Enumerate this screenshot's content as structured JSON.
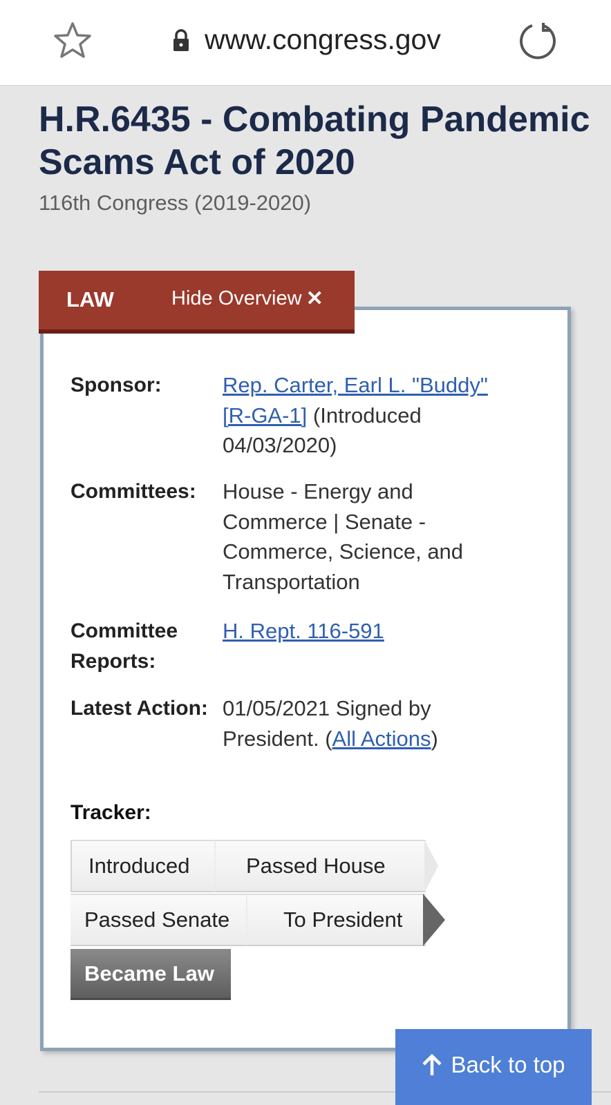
{
  "browser": {
    "url": "www.congress.gov"
  },
  "bill": {
    "title": "H.R.6435 - Combating Pandemic Scams Act of 2020",
    "congress": "116th Congress (2019-2020)"
  },
  "overview": {
    "status_tab": "LAW",
    "hide_label": "Hide Overview",
    "sponsor_label": "Sponsor:",
    "sponsor_link": "Rep. Carter, Earl L. \"Buddy\" [R-GA-1]",
    "sponsor_note": " (Introduced 04/03/2020)",
    "committees_label": "Committees:",
    "committees_value": "House - Energy and Commerce | Senate - Commerce, Science, and Transportation",
    "reports_label": "Committee Reports:",
    "reports_link": "H. Rept. 116-591",
    "latest_label": "Latest Action:",
    "latest_text": "01/05/2021 Signed by President.  (",
    "latest_link": "All Actions",
    "latest_close": ")",
    "tracker_label": "Tracker:",
    "tracker_steps": [
      "Introduced",
      "Passed House",
      "Passed Senate",
      "To President",
      "Became Law"
    ]
  },
  "back_to_top": "Back to top",
  "colors": {
    "law_tab": "#9a3a2c",
    "link": "#2f5fb0",
    "back_to_top": "#4f7fd6",
    "title": "#1c2a4a"
  }
}
